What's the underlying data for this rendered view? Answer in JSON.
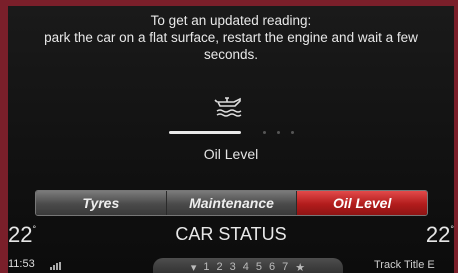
{
  "message": {
    "line1": "To get an updated reading:",
    "line2": "park the car on a flat surface, restart the engine and wait a few",
    "line3": "seconds."
  },
  "gauge": {
    "level": 0.55,
    "icon": "oil-can-icon"
  },
  "oil_label": "Oil Level",
  "tabs": [
    {
      "label": "Tyres",
      "active": false
    },
    {
      "label": "Maintenance",
      "active": false
    },
    {
      "label": "Oil Level",
      "active": true
    }
  ],
  "status_bar": {
    "temp_left": "22",
    "temp_right": "22",
    "degree": "°",
    "title": "CAR STATUS",
    "clock": "11:53",
    "presets": [
      "▾",
      "1",
      "2",
      "3",
      "4",
      "5",
      "6",
      "7",
      "★"
    ],
    "track_title": "Track Title E"
  },
  "colors": {
    "accent_active_tab": "#b21c1c",
    "frame": "#7a1f2a"
  }
}
